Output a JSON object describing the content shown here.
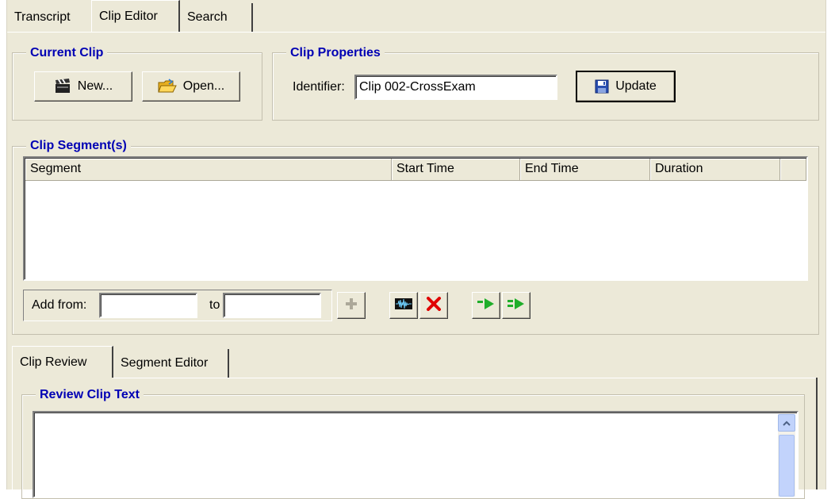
{
  "top_tabs": [
    "Transcript",
    "Clip Editor",
    "Search"
  ],
  "current_clip": {
    "title": "Current Clip",
    "new_label": "New...",
    "open_label": "Open..."
  },
  "clip_properties": {
    "title": "Clip Properties",
    "identifier_label": "Identifier:",
    "identifier_value": "Clip 002-CrossExam",
    "update_label": "Update"
  },
  "clip_segments": {
    "title": "Clip Segment(s)",
    "columns": [
      "Segment",
      "Start Time",
      "End Time",
      "Duration"
    ],
    "rows": [],
    "add_from_label": "Add from:",
    "add_from_value": "",
    "to_label": "to",
    "to_value": ""
  },
  "bottom_tabs": [
    "Clip Review",
    "Segment Editor"
  ],
  "review": {
    "title": "Review Clip Text",
    "text": ""
  },
  "colors": {
    "panel_bg": "#ece9d8",
    "group_title": "#0000b4",
    "green_icon": "#1fae2a",
    "red_icon": "#e00000",
    "scrollbar": "#c2d3fc"
  }
}
